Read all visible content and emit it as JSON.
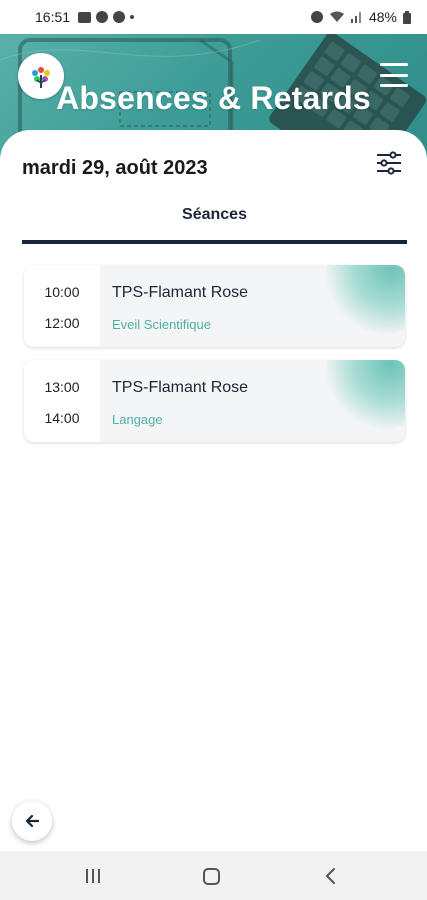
{
  "status_bar": {
    "time": "16:51",
    "battery": "48%"
  },
  "header": {
    "title": "Absences & Retards"
  },
  "date_label": "mardi 29, août 2023",
  "tabs": [
    {
      "label": "Séances",
      "active": true
    }
  ],
  "sessions": [
    {
      "start": "10:00",
      "end": "12:00",
      "class": "TPS-Flamant Rose",
      "subject": "Eveil Scientifique"
    },
    {
      "start": "13:00",
      "end": "14:00",
      "class": "TPS-Flamant Rose",
      "subject": "Langage"
    }
  ],
  "icons": {
    "logo": "app-logo-icon",
    "menu": "hamburger-menu-icon",
    "filter": "sliders-filter-icon",
    "back": "arrow-left-icon"
  },
  "colors": {
    "accent": "#4fb0a4",
    "header_bg": "#3e9d97",
    "tab_underline": "#14253a"
  }
}
